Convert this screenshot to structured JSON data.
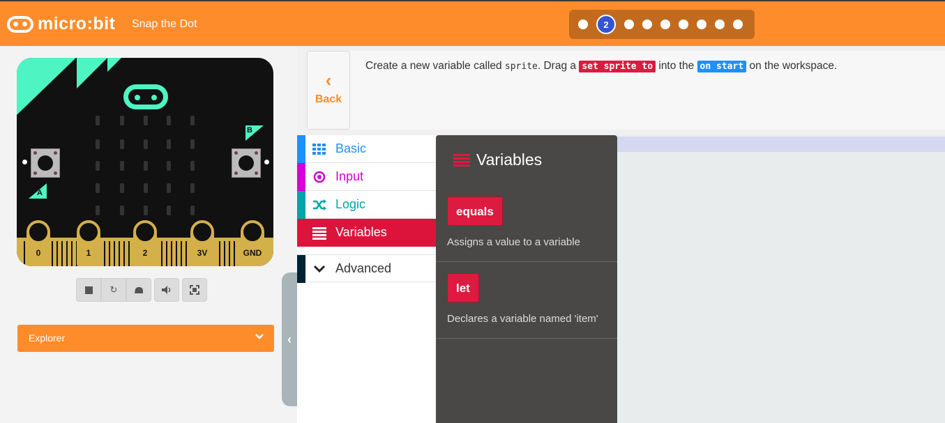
{
  "header": {
    "logo": "micro:bit",
    "tutorial_title": "Snap the Dot",
    "current_step": "2",
    "step_count_before": 1,
    "step_count_after": 7
  },
  "tutorial": {
    "back_label": "Back",
    "instruction_parts": {
      "p1": "Create a new variable called ",
      "code1": "sprite",
      "p2": ". Drag a ",
      "block1": "set sprite to",
      "p3": " into the ",
      "block2": "on start",
      "p4": " on the workspace."
    }
  },
  "simulator": {
    "button_a_label": "A",
    "button_b_label": "B",
    "pins": [
      "0",
      "1",
      "2",
      "3V",
      "GND"
    ],
    "toolbar": {
      "stop_icon": "stop-icon",
      "restart_icon": "restart-icon",
      "slowmo_icon": "snail-icon",
      "sound_icon": "sound-icon",
      "fullscreen_icon": "fullscreen-icon"
    }
  },
  "explorer": {
    "label": "Explorer"
  },
  "toolbox": {
    "categories": [
      {
        "label": "Basic",
        "color": "#1e90ff",
        "icon": "grid-icon"
      },
      {
        "label": "Input",
        "color": "#d400d4",
        "icon": "target-icon"
      },
      {
        "label": "Logic",
        "color": "#00a4a6",
        "icon": "shuffle-icon"
      },
      {
        "label": "Variables",
        "color": "#dc143c",
        "icon": "list-icon",
        "selected": true
      },
      {
        "label": "Advanced",
        "color": "#002233",
        "icon": "chevron-down-icon"
      }
    ]
  },
  "flyout": {
    "title": "Variables",
    "blocks": [
      {
        "label": "equals",
        "description": "Assigns a value to a variable"
      },
      {
        "label": "let",
        "description": "Declares a variable named 'item'"
      }
    ]
  },
  "colors": {
    "brand_orange": "#ff8c2a",
    "variables_red": "#dc143c",
    "step_blue": "#3454d1",
    "board_accent": "#4ef5c2"
  }
}
